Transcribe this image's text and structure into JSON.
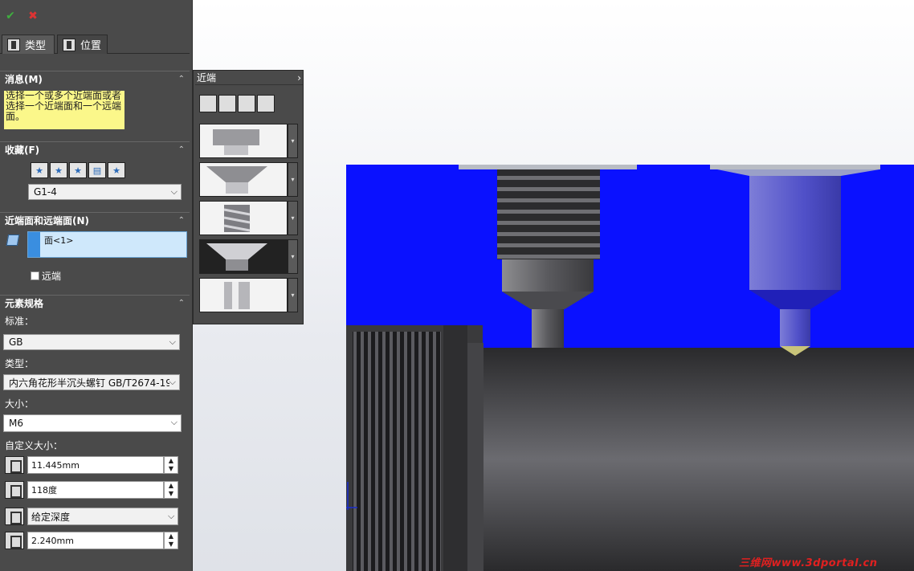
{
  "toolbar": {
    "ok_icon": "checkmark-icon",
    "cancel_icon": "close-icon"
  },
  "tabs": [
    {
      "label": "类型",
      "icon": "hole-type-icon",
      "active": true
    },
    {
      "label": "位置",
      "icon": "hole-position-icon",
      "active": false
    }
  ],
  "message": {
    "header": "消息(M)",
    "text": "选择一个或多个近端面或者选择一个近端面和一个远端面。"
  },
  "favorites": {
    "header": "收藏(F)",
    "buttons": [
      "apply-default-icon",
      "add-favorite-icon",
      "delete-favorite-icon",
      "save-favorite-icon",
      "load-favorite-icon"
    ],
    "selected": "G1-4"
  },
  "faces": {
    "header": "近端面和远端面(N)",
    "items": [
      "面<1>"
    ],
    "far_side_label": "远端",
    "far_side_checked": false
  },
  "spec": {
    "header": "元素规格",
    "standard_label": "标准：",
    "standard_value": "GB",
    "type_label": "类型：",
    "type_value": "内六角花形半沉头螺钉 GB/T2674-19",
    "size_label": "大小：",
    "size_value": "M6",
    "custom_size_label": "自定义大小：",
    "diameter_value": "11.445mm",
    "angle_value": "118度",
    "depth_mode_value": "给定深度",
    "depth_value": "2.240mm"
  },
  "flyout": {
    "title": "近端",
    "tool_icons": [
      "counterbore-icon",
      "countersink-icon",
      "remove-icon",
      "tolerance-icon"
    ],
    "shapes": [
      "counterbore-shape",
      "countersink-shape",
      "tapped-shape",
      "countersink-selected-shape",
      "straight-shape"
    ]
  },
  "watermark": "三维网www.3dportal.cn",
  "colors": {
    "panel": "#4a4a4a",
    "model_blue": "#0a11ff",
    "message_bg": "#fbf78a",
    "selection": "#3a8ee0"
  }
}
